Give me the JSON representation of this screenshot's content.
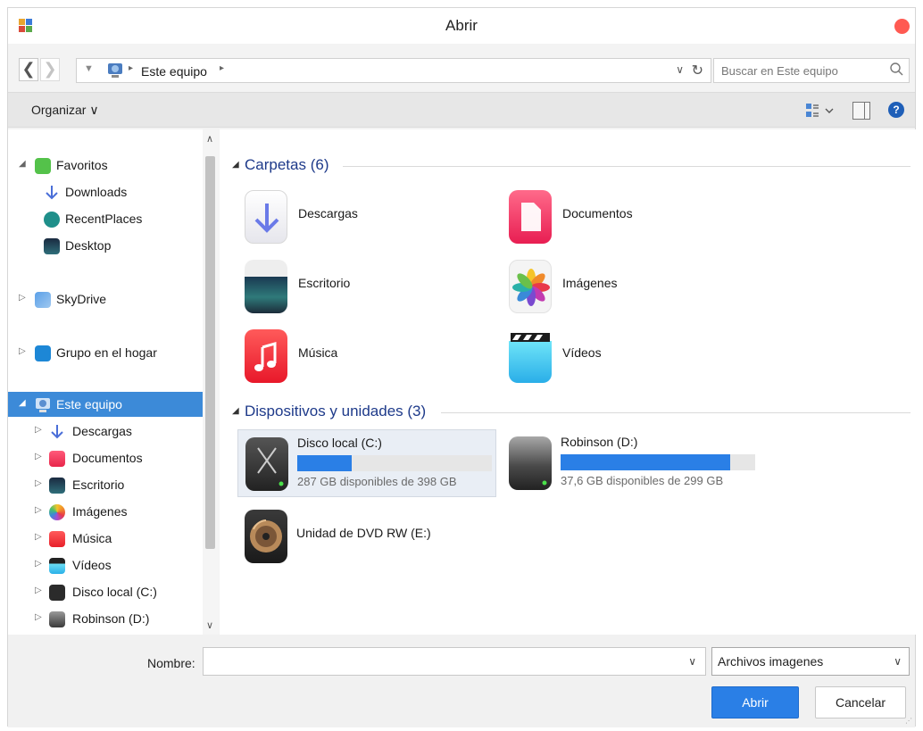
{
  "window": {
    "title": "Abrir"
  },
  "nav": {
    "back": "❮",
    "forward": "❯",
    "crumb_dropdown": "▼",
    "crumb_sep": "▸",
    "crumb": "Este equipo",
    "address_dropdown": "∨",
    "refresh": "↻"
  },
  "search": {
    "placeholder": "Buscar en Este equipo"
  },
  "toolbar": {
    "organize": "Organizar ∨",
    "help": "?"
  },
  "sidebar": {
    "scroll_up": "∧",
    "scroll_down": "∨",
    "groups": [
      {
        "label": "Favoritos",
        "expander": "◢"
      },
      {
        "label": "Downloads"
      },
      {
        "label": "RecentPlaces"
      },
      {
        "label": "Desktop"
      },
      {
        "label": "SkyDrive",
        "expander": "▷"
      },
      {
        "label": "Grupo en el hogar",
        "expander": "▷"
      },
      {
        "label": "Este equipo",
        "expander": "◢"
      },
      {
        "label": "Descargas",
        "expander": "▷"
      },
      {
        "label": "Documentos",
        "expander": "▷"
      },
      {
        "label": "Escritorio",
        "expander": "▷"
      },
      {
        "label": "Imágenes",
        "expander": "▷"
      },
      {
        "label": "Música",
        "expander": "▷"
      },
      {
        "label": "Vídeos",
        "expander": "▷"
      },
      {
        "label": "Disco local (C:)",
        "expander": "▷"
      },
      {
        "label": "Robinson (D:)",
        "expander": "▷"
      }
    ]
  },
  "main": {
    "folders_header": "Carpetas (6)",
    "folders": [
      {
        "name": "Descargas"
      },
      {
        "name": "Documentos"
      },
      {
        "name": "Escritorio"
      },
      {
        "name": "Imágenes"
      },
      {
        "name": "Música"
      },
      {
        "name": "Vídeos"
      }
    ],
    "devices_header": "Dispositivos y unidades (3)",
    "devices": [
      {
        "name": "Disco local (C:)",
        "free_text": "287 GB disponibles de 398 GB",
        "used_fraction": 0.28
      },
      {
        "name": "Robinson (D:)",
        "free_text": "37,6 GB disponibles de 299 GB",
        "used_fraction": 0.87
      },
      {
        "name": "Unidad de DVD RW (E:)"
      }
    ],
    "tri": "◢"
  },
  "footer": {
    "name_label": "Nombre:",
    "name_value": "",
    "name_dropdown": "∨",
    "type_value": "Archivos imagenes",
    "type_dropdown": "∨",
    "open_button": "Abrir",
    "cancel_button": "Cancelar"
  },
  "colors": {
    "selection": "#3c8ad8",
    "primary_button": "#2a7fe6",
    "group_header": "#1e3a8a",
    "close_dot": "#ff5a52"
  }
}
